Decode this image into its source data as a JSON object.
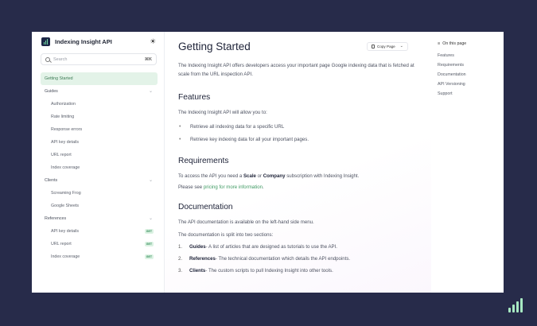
{
  "brand": {
    "title": "Indexing Insight API",
    "logo_icon": "bar-chart-logo-icon",
    "theme_icon": "sun-icon"
  },
  "search": {
    "placeholder": "Search",
    "shortcut": "⌘K"
  },
  "sidebar": {
    "items": [
      {
        "label": "Getting Started",
        "type": "link",
        "active": true
      },
      {
        "label": "Guides",
        "type": "group"
      },
      {
        "label": "Authorization",
        "type": "sub"
      },
      {
        "label": "Rate limiting",
        "type": "sub"
      },
      {
        "label": "Response errors",
        "type": "sub"
      },
      {
        "label": "API key details",
        "type": "sub"
      },
      {
        "label": "URL report",
        "type": "sub"
      },
      {
        "label": "Index coverage",
        "type": "sub"
      },
      {
        "label": "Clients",
        "type": "group"
      },
      {
        "label": "Screaming Frog",
        "type": "sub"
      },
      {
        "label": "Google Sheets",
        "type": "sub"
      },
      {
        "label": "References",
        "type": "group"
      },
      {
        "label": "API key details",
        "type": "sub",
        "badge": "GET"
      },
      {
        "label": "URL report",
        "type": "sub",
        "badge": "GET"
      },
      {
        "label": "Index coverage",
        "type": "sub",
        "badge": "GET"
      }
    ]
  },
  "main": {
    "title": "Getting Started",
    "copy_label": "Copy Page",
    "intro": "The Indexing Insight API offers developers access your important page Google indexing data that is fetched at scale from the URL inspection API.",
    "features": {
      "heading": "Features",
      "lead": "The Indexing Insight API will allow you to:",
      "bullets": [
        "Retrieve all indexing data for a specific URL",
        "Retrieve key indexing data for all your important pages."
      ]
    },
    "requirements": {
      "heading": "Requirements",
      "text_1": "To access the API you need a ",
      "scale": "Scale",
      "text_2": " or ",
      "company": "Company",
      "text_3": " subscription with Indexing Insight.",
      "see_prefix": "Please see ",
      "see_link": "pricing for more information",
      "see_suffix": "."
    },
    "documentation": {
      "heading": "Documentation",
      "p1": "The API documentation is available on the left-hand side menu.",
      "p2": "The documentation is split into two sections:",
      "items": [
        {
          "num": "1.",
          "term": "Guides",
          "desc": " - A list of articles that are designed as tutorials to use the API."
        },
        {
          "num": "2.",
          "term": "References",
          "desc": " - The technical documentation which details the API endpoints."
        },
        {
          "num": "3.",
          "term": "Clients",
          "desc": " - The custom scripts to pull Indexing Insight into other tools."
        }
      ]
    }
  },
  "toc": {
    "heading": "On this page",
    "items": [
      "Features",
      "Requirements",
      "Documentation",
      "API Versioning",
      "Support"
    ]
  },
  "colors": {
    "background": "#272b4a",
    "accent": "#3f9a63",
    "active_bg": "#e3f3e8"
  }
}
